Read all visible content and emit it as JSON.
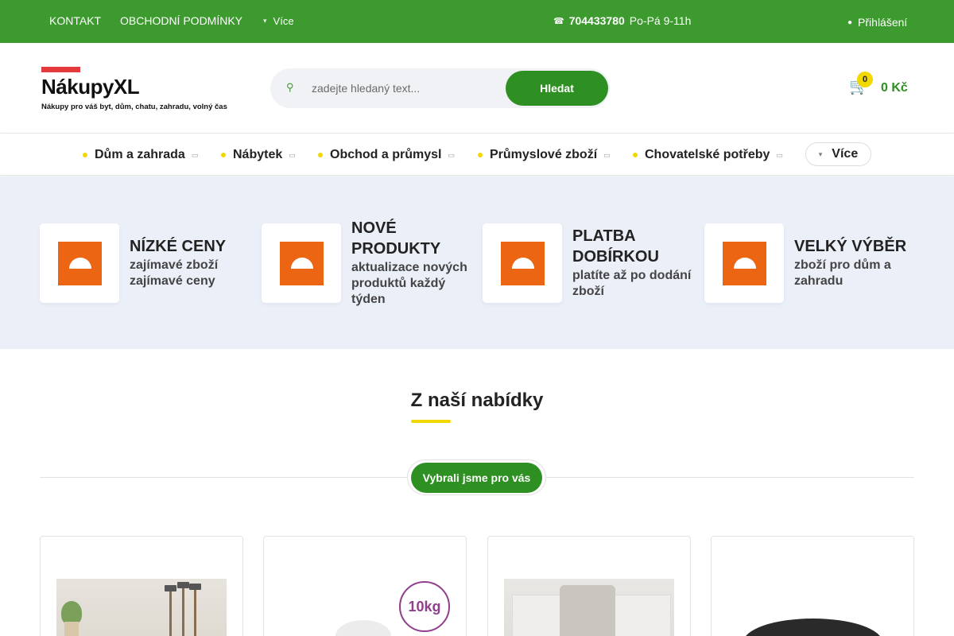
{
  "topbar": {
    "links": [
      "KONTAKT",
      "OBCHODNÍ PODMÍNKY"
    ],
    "more_label": "Více",
    "phone_number": "704433780",
    "phone_hours": "Po-Pá 9-11h",
    "login_label": "Přihlášení"
  },
  "header": {
    "logo_name": "NákupyXL",
    "logo_tagline": "Nákupy pro váš byt, dům, chatu, zahradu, volný čas",
    "search_placeholder": "zadejte hledaný text...",
    "search_button": "Hledat",
    "cart_count": "0",
    "cart_total": "0 Kč"
  },
  "categories": [
    {
      "label": "Dům a zahrada"
    },
    {
      "label": "Nábytek"
    },
    {
      "label": "Obchod a průmysl"
    },
    {
      "label": "Průmyslové zboží"
    },
    {
      "label": "Chovatelské potřeby"
    }
  ],
  "categories_more": "Více",
  "benefits": [
    {
      "title": "NÍZKÉ CENY",
      "text": "zajímavé zboží zajímavé ceny"
    },
    {
      "title": "NOVÉ PRODUKTY",
      "text": "aktualizace nových produktů každý týden"
    },
    {
      "title": "PLATBA DOBÍRKOU",
      "text": "platíte až po dodání zboží"
    },
    {
      "title": "VELKÝ VÝBĚR",
      "text": "zboží pro dům a zahradu"
    }
  ],
  "offer": {
    "title": "Z naší nabídky",
    "tab_label": "Vybrali jsme pro vás"
  },
  "products": [
    {
      "badge": ""
    },
    {
      "badge": "10kg"
    },
    {
      "badge": ""
    },
    {
      "badge": ""
    }
  ],
  "colors": {
    "brand_green": "#3c9a2e",
    "button_green": "#2e8f22",
    "accent_yellow": "#f0d800",
    "benefit_orange": "#ec6513",
    "benefits_bg": "#ebeff8"
  },
  "icons": {
    "more": "chevron-down-icon",
    "phone": "phone-icon",
    "login": "user-icon",
    "search": "search-icon",
    "cart": "cart-icon",
    "benefit": "benefit-icon"
  }
}
